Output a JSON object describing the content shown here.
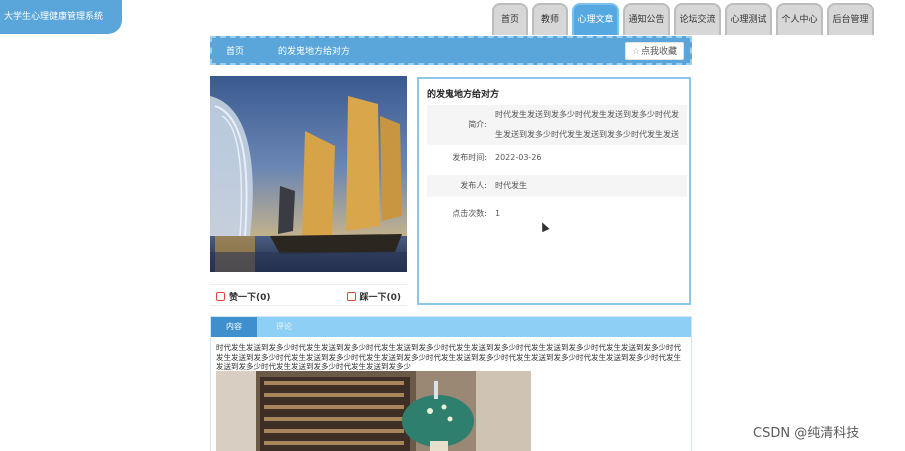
{
  "header": {
    "site_title": "大学生心理健康管理系统"
  },
  "nav": {
    "items": [
      {
        "label": "首页"
      },
      {
        "label": "教师"
      },
      {
        "label": "心理文章"
      },
      {
        "label": "通知公告"
      },
      {
        "label": "论坛交流"
      },
      {
        "label": "心理测试"
      },
      {
        "label": "个人中心"
      },
      {
        "label": "后台管理"
      }
    ],
    "active": "心理文章"
  },
  "breadcrumb": {
    "home": "首页",
    "current": "的发鬼地方给对方"
  },
  "favorite": {
    "star": "☆",
    "label": "点我收藏"
  },
  "actions": {
    "like": "赞一下(0)",
    "dislike": "踩一下(0)"
  },
  "article": {
    "title": "的发鬼地方给对方",
    "intro_label": "简介:",
    "intro": "时代发生发送到发多少时代发生发送到发多少时代发生发送到发多少时代发生发送到发多少时代发生发送到发多少",
    "time_label": "发布时间:",
    "time": "2022-03-26",
    "author_label": "发布人:",
    "author": "时代发生",
    "clicks_label": "点击次数:",
    "clicks": "1"
  },
  "tabs": {
    "content": "内容",
    "comment": "评论"
  },
  "content": {
    "text": "时代发生发送到发多少时代发生发送到发多少时代发生发送到发多少时代发生发送到发多少时代发生发送到发多少时代发生发送到发多少时代发生发送到发多少时代发生发送到发多少时代发生发送到发多少时代发生发送到发多少时代发生发送到发多少时代发生发送到发多少时代发生发送到发多少时代发生发送到发多少时代发生发送到发多少"
  },
  "watermark": "CSDN @纯清科技",
  "colors": {
    "primary": "#5aa5d9",
    "tab_bar": "#8ed0f5",
    "tab_active": "#3f8fcf",
    "panel_border": "#8cc7ea"
  }
}
